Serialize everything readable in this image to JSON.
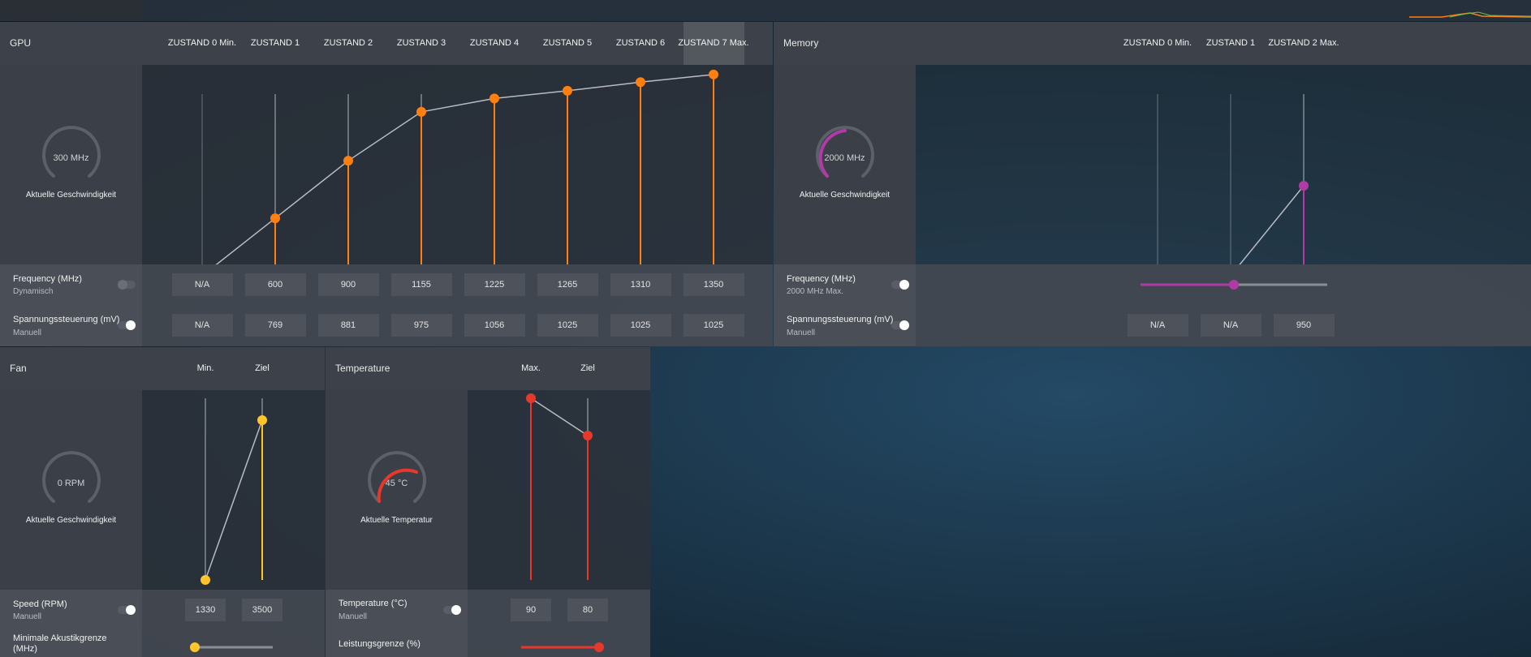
{
  "gpu": {
    "title": "GPU",
    "states": [
      "ZUSTAND 0 Min.",
      "ZUSTAND 1",
      "ZUSTAND 2",
      "ZUSTAND 3",
      "ZUSTAND 4",
      "ZUSTAND 5",
      "ZUSTAND 6",
      "ZUSTAND 7 Max."
    ],
    "gauge_value": "300 MHz",
    "gauge_label": "Aktuelle Geschwindigkeit",
    "frequency_label": "Frequency (MHz)",
    "frequency_mode": "Dynamisch",
    "frequencies": [
      "N/A",
      "600",
      "900",
      "1155",
      "1225",
      "1265",
      "1310",
      "1350"
    ],
    "voltage_label": "Spannungssteuerung (mV)",
    "voltage_mode": "Manuell",
    "voltages": [
      "N/A",
      "769",
      "881",
      "975",
      "1056",
      "1025",
      "1025",
      "1025"
    ],
    "accent_color": "#ff7f11"
  },
  "memory": {
    "title": "Memory",
    "states": [
      "ZUSTAND 0 Min.",
      "ZUSTAND 1",
      "ZUSTAND 2 Max."
    ],
    "gauge_value": "2000 MHz",
    "gauge_label": "Aktuelle Geschwindigkeit",
    "frequency_label": "Frequency (MHz)",
    "frequency_mode": "2000 MHz Max.",
    "slider_fraction": 0.5,
    "voltage_label": "Spannungssteuerung (mV)",
    "voltage_mode": "Manuell",
    "voltages": [
      "N/A",
      "N/A",
      "950"
    ],
    "accent_color": "#b03aa6"
  },
  "fan": {
    "title": "Fan",
    "columns": [
      "Min.",
      "Ziel"
    ],
    "gauge_value": "0 RPM",
    "gauge_label": "Aktuelle Geschwindigkeit",
    "speed_label": "Speed (RPM)",
    "speed_mode": "Manuell",
    "speeds": [
      "1330",
      "3500"
    ],
    "acoustic_label": "Minimale Akustikgrenze (MHz)",
    "acoustic_fraction": 0.0,
    "accent_color": "#ffc52a"
  },
  "temperature": {
    "title": "Temperature",
    "columns": [
      "Max.",
      "Ziel"
    ],
    "gauge_value": "45 °C",
    "gauge_label": "Aktuelle Temperatur",
    "temp_label": "Temperature (°C)",
    "temp_mode": "Manuell",
    "temps": [
      "90",
      "80"
    ],
    "power_label": "Leistungsgrenze (%)",
    "power_fraction": 1.0,
    "accent_color": "#e8372b"
  }
}
